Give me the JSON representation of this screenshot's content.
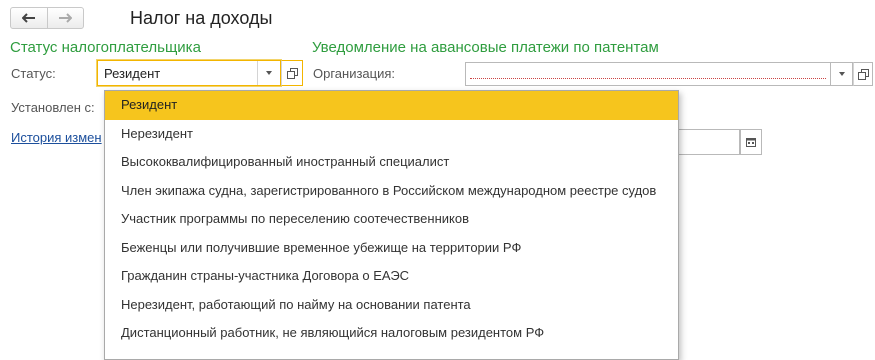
{
  "header": {
    "title": "Налог на доходы",
    "back_icon": "arrow-left-icon",
    "forward_icon": "arrow-right-icon"
  },
  "taxpayer_status": {
    "section_title": "Статус налогоплательщика",
    "status_label": "Статус:",
    "status_value": "Резидент",
    "set_since_label": "Установлен с:",
    "history_link": "История измен"
  },
  "advance_notice": {
    "section_title": "Уведомление на авансовые платежи по патентам",
    "organization_label": "Организация:",
    "organization_value": ""
  },
  "status_options": [
    "Резидент",
    "Нерезидент",
    "Высококвалифицированный иностранный специалист",
    "Член экипажа судна, зарегистрированного в Российском международном реестре судов",
    "Участник программы по переселению соотечественников",
    "Беженцы или получившие временное убежище на территории РФ",
    "Гражданин страны-участника Договора о ЕАЭС",
    "Нерезидент, работающий по найму на основании патента",
    "Дистанционный работник, не являющийся налоговым резидентом РФ"
  ],
  "selected_option": "Резидент",
  "colors": {
    "section_title": "#2f9d3f",
    "highlight": "#f6c51d",
    "focus_border": "#f3b500",
    "link": "#1c4f9c"
  }
}
